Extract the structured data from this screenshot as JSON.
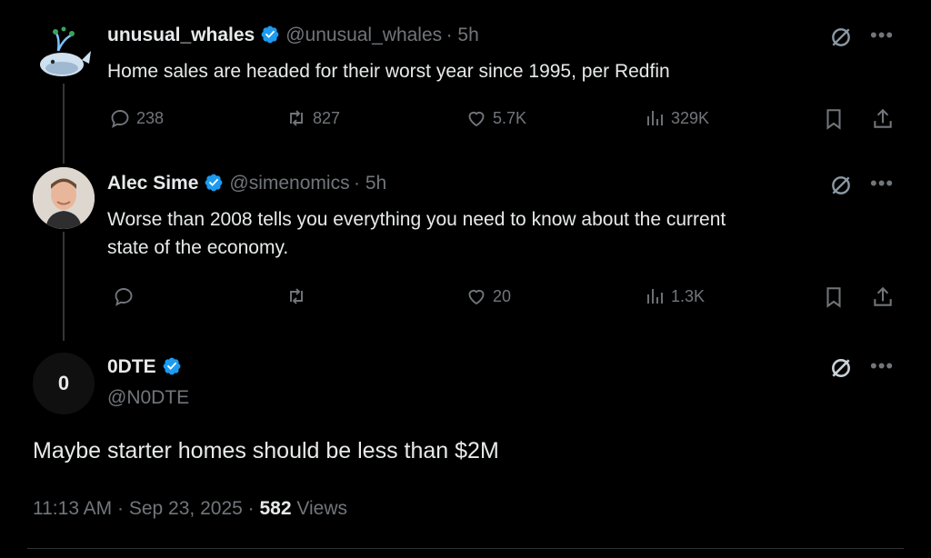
{
  "tweets": [
    {
      "name": "unusual_whales",
      "handle": "@unusual_whales",
      "time": "· 5h",
      "text": "Home sales are headed for their worst year since 1995, per Redfin",
      "replies": "238",
      "reposts": "827",
      "likes": "5.7K",
      "views": "329K"
    },
    {
      "name": "Alec Sime",
      "handle": "@simenomics",
      "time": "· 5h",
      "text_line1": "Worse than 2008 tells you everything you need to know about the current",
      "text_line2": "state of the economy.",
      "replies": "",
      "reposts": "",
      "likes": "20",
      "views": "1.3K"
    }
  ],
  "main": {
    "avatar_letter": "0",
    "name": "0DTE",
    "handle": "@N0DTE",
    "text": "Maybe starter homes should be less than $2M",
    "time": "11:13 AM",
    "date": "Sep 23, 2025",
    "views_count": "582",
    "views_label": "Views"
  },
  "colors": {
    "background": "#000000",
    "text": "#e7e9ea",
    "muted": "#71767b",
    "verified": "#1d9bf0"
  },
  "icons": [
    "grok-icon",
    "more-icon",
    "reply-icon",
    "repost-icon",
    "like-icon",
    "views-icon",
    "bookmark-icon",
    "share-icon",
    "verified-badge-icon"
  ]
}
